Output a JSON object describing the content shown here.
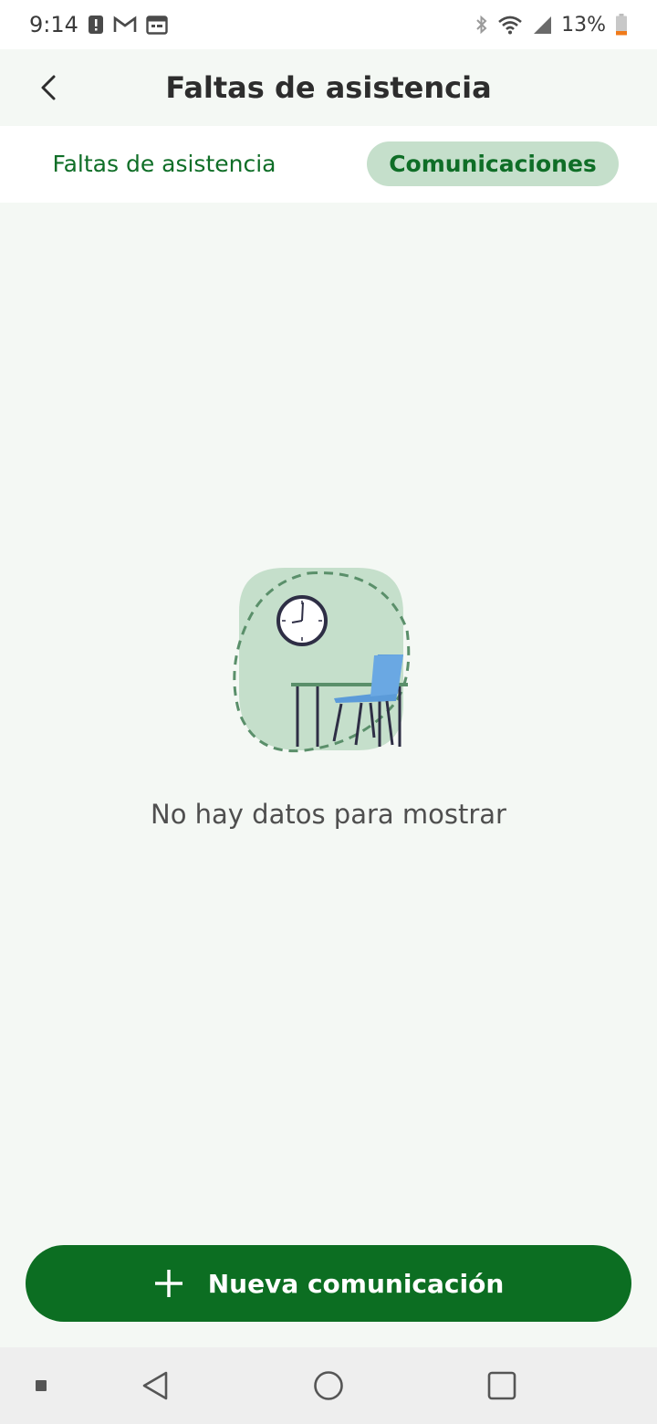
{
  "status_bar": {
    "time": "9:14",
    "battery_percent": "13%",
    "icons_left": [
      "alert-icon",
      "gmail-icon",
      "calendar-icon"
    ],
    "icons_right": [
      "bluetooth-icon",
      "wifi-icon",
      "signal-icon",
      "battery-icon"
    ]
  },
  "app_bar": {
    "title": "Faltas de asistencia"
  },
  "tabs": [
    {
      "label": "Faltas de asistencia",
      "selected": false
    },
    {
      "label": "Comunicaciones",
      "selected": true
    }
  ],
  "empty_state": {
    "message": "No hay datos para mostrar"
  },
  "new_button": {
    "label": "Nueva comunicación"
  },
  "colors": {
    "primary": "#0c6e22",
    "tab_selected_bg": "#c5dfcb",
    "background": "#f4f8f4",
    "illustration_bg": "#c5dfcb",
    "chair": "#5b9bd9"
  }
}
